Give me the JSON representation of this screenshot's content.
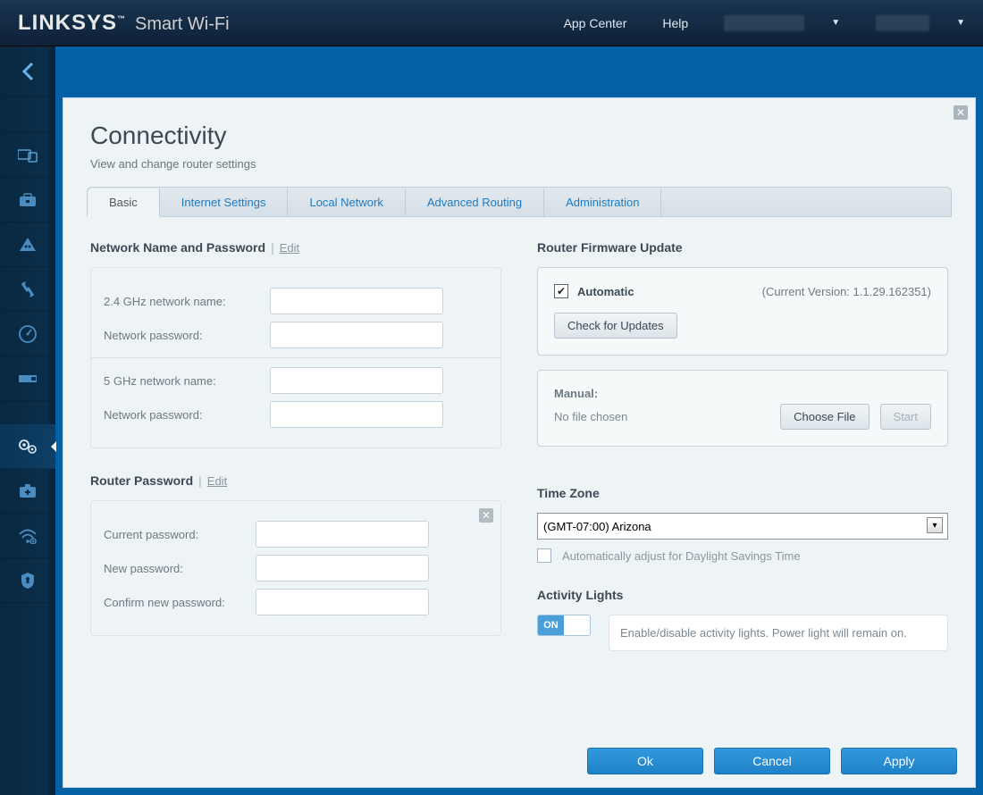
{
  "header": {
    "brand": "LINKSYS",
    "tm": "™",
    "product": "Smart Wi-Fi",
    "app_center": "App Center",
    "help": "Help"
  },
  "page": {
    "title": "Connectivity",
    "subtitle": "View and change router settings"
  },
  "tabs": [
    "Basic",
    "Internet Settings",
    "Local Network",
    "Advanced Routing",
    "Administration"
  ],
  "network": {
    "section_label": "Network Name and Password",
    "edit": "Edit",
    "ghz24_label": "2.4 GHz network name:",
    "ghz24_value": "",
    "ghz24_pwd_label": "Network password:",
    "ghz24_pwd_value": "",
    "ghz5_label": "5 GHz network name:",
    "ghz5_value": "",
    "ghz5_pwd_label": "Network password:",
    "ghz5_pwd_value": ""
  },
  "router_pwd": {
    "section_label": "Router Password",
    "edit": "Edit",
    "current_label": "Current password:",
    "new_label": "New password:",
    "confirm_label": "Confirm new password:"
  },
  "firmware": {
    "section_label": "Router Firmware Update",
    "auto_label": "Automatic",
    "auto_checked": true,
    "version_label": "(Current Version: 1.1.29.162351)",
    "check_btn": "Check for Updates",
    "manual_label": "Manual:",
    "no_file": "No file chosen",
    "choose_btn": "Choose File",
    "start_btn": "Start"
  },
  "timezone": {
    "section_label": "Time Zone",
    "value": "(GMT-07:00) Arizona",
    "dst_label": "Automatically adjust for Daylight Savings Time",
    "dst_checked": false
  },
  "activity": {
    "section_label": "Activity Lights",
    "toggle_label": "ON",
    "desc": "Enable/disable activity lights. Power light will remain on."
  },
  "footer": {
    "ok": "Ok",
    "cancel": "Cancel",
    "apply": "Apply"
  }
}
